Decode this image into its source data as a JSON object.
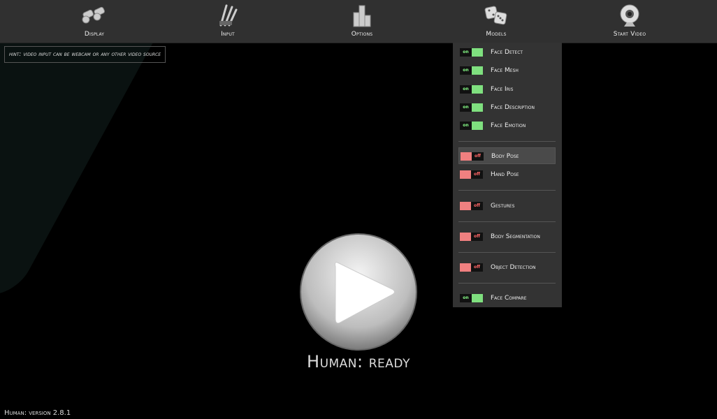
{
  "menu": [
    {
      "label": "Display",
      "icon": "binoculars-icon"
    },
    {
      "label": "Input",
      "icon": "brushes-icon"
    },
    {
      "label": "Options",
      "icon": "chart-blocks-icon"
    },
    {
      "label": "Models",
      "icon": "dice-icon"
    },
    {
      "label": "Start Video",
      "icon": "webcam-icon"
    }
  ],
  "hint": "hint: video input can be webcam or any other video source",
  "models": {
    "on_text": "on",
    "off_text": "off",
    "items": [
      {
        "label": "Face Detect",
        "state": "on"
      },
      {
        "label": "Face Mesh",
        "state": "on"
      },
      {
        "label": "Face Iris",
        "state": "on"
      },
      {
        "label": "Face Description",
        "state": "on"
      },
      {
        "label": "Face Emotion",
        "state": "on"
      },
      {
        "label": "Body Pose",
        "state": "off"
      },
      {
        "label": "Hand Pose",
        "state": "off"
      },
      {
        "label": "Gestures",
        "state": "off"
      },
      {
        "label": "Body Segmentation",
        "state": "off"
      },
      {
        "label": "Object Detection",
        "state": "off"
      },
      {
        "label": "Face Compare",
        "state": "on"
      }
    ]
  },
  "status": "Human: ready",
  "version": "Human: version 2.8.1",
  "colors": {
    "on": "#7fe07f",
    "off": "#f08080",
    "menu_bg": "#303030"
  }
}
